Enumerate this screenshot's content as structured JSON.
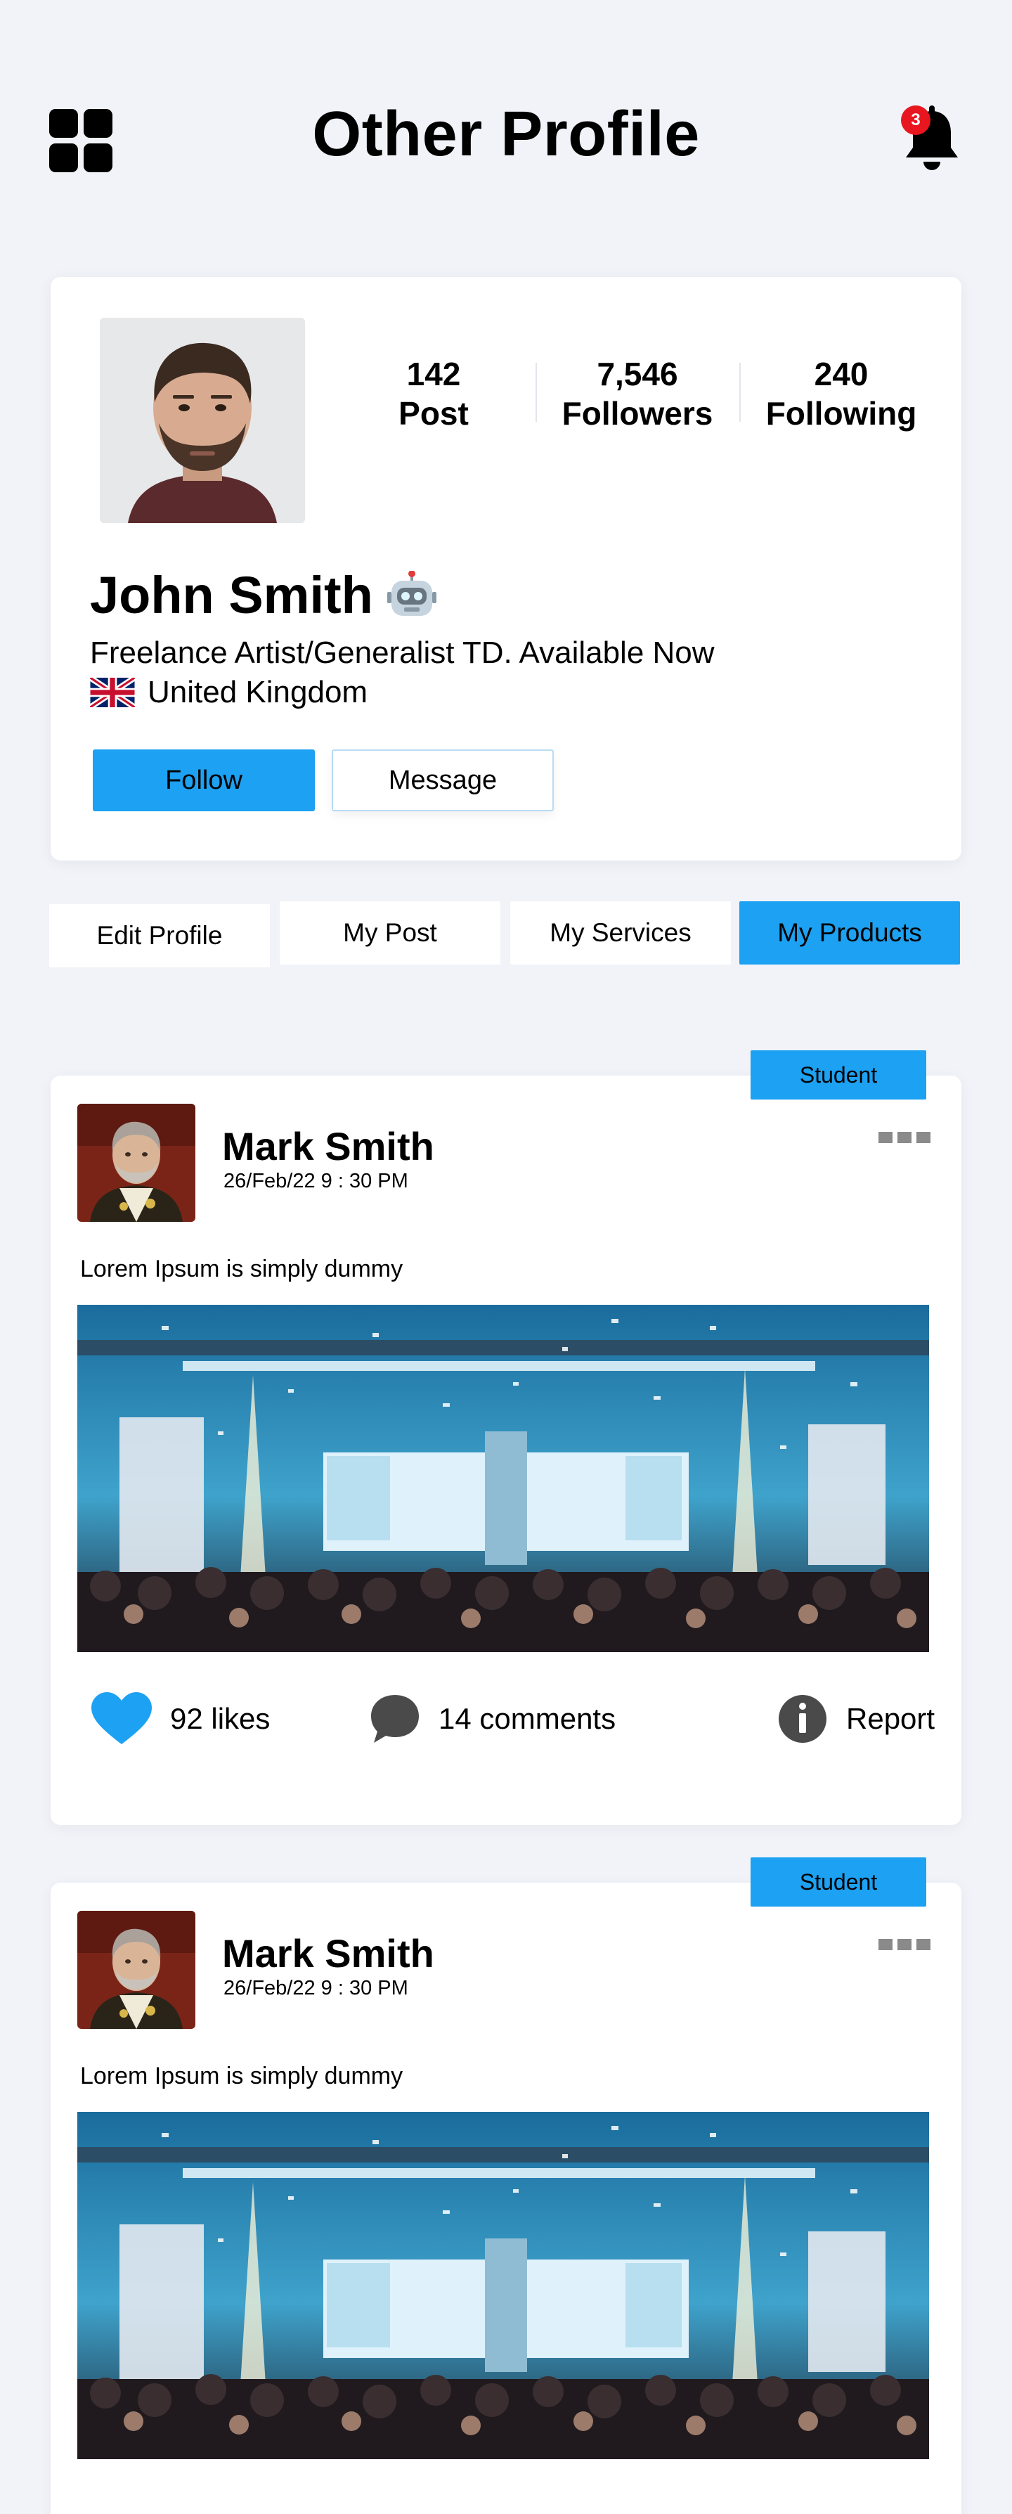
{
  "header": {
    "title": "Other Profile",
    "notification_count": "3",
    "icons": [
      "grid-menu-icon",
      "bell-icon"
    ]
  },
  "profile": {
    "stats": [
      {
        "value": "142",
        "label": "Post"
      },
      {
        "value": "7,546",
        "label": "Followers"
      },
      {
        "value": "240",
        "label": "Following"
      }
    ],
    "name": "John Smith",
    "bio": "Freelance Artist/Generalist TD. Available Now",
    "country": "United Kingdom",
    "follow_label": "Follow",
    "message_label": "Message"
  },
  "tabs": [
    {
      "label": "Edit Profile",
      "active": false
    },
    {
      "label": "My Post",
      "active": false
    },
    {
      "label": "My Services",
      "active": false
    },
    {
      "label": "My Products",
      "active": true
    }
  ],
  "posts": [
    {
      "badge": "Student",
      "author": "Mark Smith",
      "date": "26/Feb/22  9 : 30 PM",
      "text": "Lorem Ipsum is simply dummy",
      "likes": "92 likes",
      "comments": "14 comments",
      "report": "Report"
    },
    {
      "badge": "Student",
      "author": "Mark Smith",
      "date": "26/Feb/22  9 : 30 PM",
      "text": "Lorem Ipsum is simply dummy"
    }
  ],
  "colors": {
    "accent": "#1da1f2",
    "background": "#f1f3f8",
    "badge_red": "#e8171f"
  }
}
